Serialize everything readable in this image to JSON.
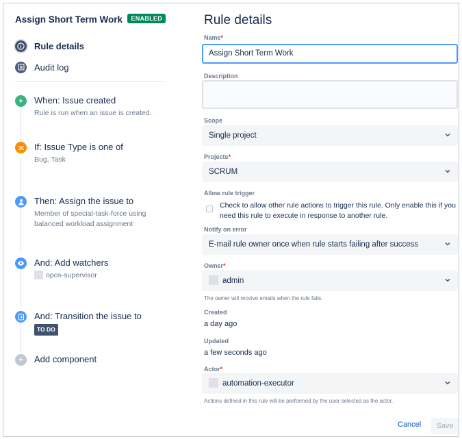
{
  "rule": {
    "title": "Assign Short Term Work",
    "status_badge": "ENABLED"
  },
  "nav": {
    "rule_details": "Rule details",
    "audit_log": "Audit log"
  },
  "components": [
    {
      "title": "When: Issue created",
      "desc": "Rule is run when an issue is created.",
      "color": "#36b37e",
      "icon": "plus-icon"
    },
    {
      "title": "If: Issue Type is one of",
      "desc": "Bug, Task",
      "color": "#ff8b00",
      "icon": "shuffle-icon"
    },
    {
      "title": "Then: Assign the issue to",
      "desc": "Member of special-task-force using balanced workload assignment",
      "color": "#4c9aff",
      "icon": "person-icon"
    },
    {
      "title": "And: Add watchers",
      "desc": "opos-supervisor",
      "color": "#4c9aff",
      "icon": "eye-icon"
    },
    {
      "title": "And: Transition the issue to",
      "desc": "TO DO",
      "color": "#4c9aff",
      "icon": "transition-icon"
    },
    {
      "title": "Add component",
      "desc": "",
      "color": "#c1c7d0",
      "icon": "plus-icon"
    }
  ],
  "details": {
    "heading": "Rule details",
    "name_label": "Name",
    "name_value": "Assign Short Term Work",
    "description_label": "Description",
    "scope_label": "Scope",
    "scope_value": "Single project",
    "projects_label": "Projects",
    "projects_value": "SCRUM",
    "allow_trigger_label": "Allow rule trigger",
    "allow_trigger_text": "Check to allow other rule actions to trigger this rule. Only enable this if you need this rule to execute in response to another rule.",
    "notify_label": "Notify on error",
    "notify_value": "E-mail rule owner once when rule starts failing after success",
    "owner_label": "Owner",
    "owner_value": "admin",
    "owner_help": "The owner will receive emails when the rule fails.",
    "created_label": "Created",
    "created_value": "a day ago",
    "updated_label": "Updated",
    "updated_value": "a few seconds ago",
    "actor_label": "Actor",
    "actor_value": "automation-executor",
    "actor_help": "Actions defined in this rule will be performed by the user selected as the actor.",
    "required_mark": "*"
  },
  "buttons": {
    "cancel": "Cancel",
    "save": "Save"
  }
}
